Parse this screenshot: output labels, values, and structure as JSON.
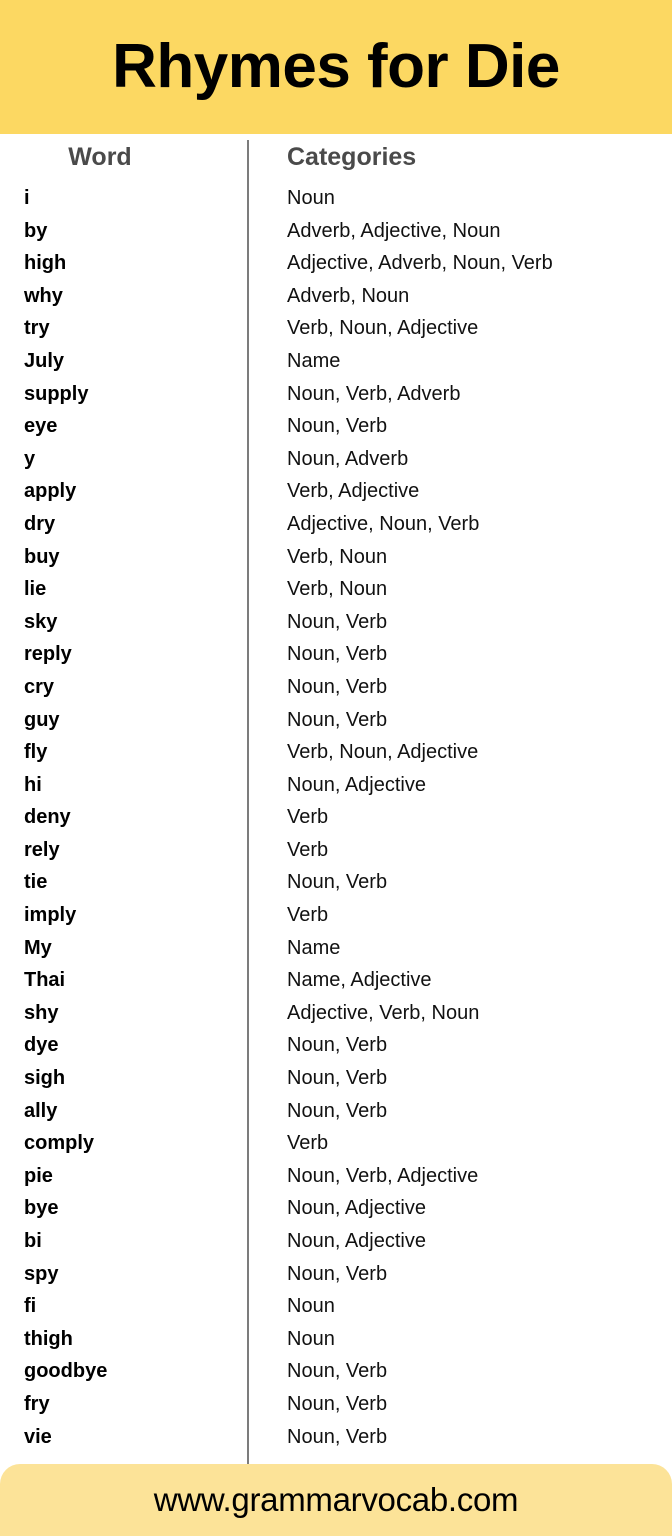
{
  "header": {
    "title": "Rhymes for Die",
    "background_color": "#fcd862"
  },
  "table": {
    "columns": [
      {
        "key": "word",
        "label": "Word"
      },
      {
        "key": "categories",
        "label": "Categories"
      }
    ],
    "divider_color": "#7c7c7c",
    "header_text_color": "#4a4a4a",
    "rows": [
      {
        "word": "i",
        "categories": "Noun"
      },
      {
        "word": "by",
        "categories": "Adverb, Adjective,  Noun"
      },
      {
        "word": "high",
        "categories": "Adjective,  Adverb,  Noun, Verb"
      },
      {
        "word": "why",
        "categories": "Adverb, Noun"
      },
      {
        "word": "try",
        "categories": "Verb, Noun, Adjective"
      },
      {
        "word": "July",
        "categories": "Name"
      },
      {
        "word": "supply",
        "categories": "Noun, Verb, Adverb"
      },
      {
        "word": "eye",
        "categories": "Noun, Verb"
      },
      {
        "word": "y",
        "categories": "Noun, Adverb"
      },
      {
        "word": "apply",
        "categories": "Verb, Adjective"
      },
      {
        "word": "dry",
        "categories": "Adjective,  Noun, Verb"
      },
      {
        "word": "buy",
        "categories": "Verb, Noun"
      },
      {
        "word": "lie",
        "categories": "Verb, Noun"
      },
      {
        "word": "sky",
        "categories": "Noun, Verb"
      },
      {
        "word": "reply",
        "categories": "Noun, Verb"
      },
      {
        "word": "cry",
        "categories": "Noun, Verb"
      },
      {
        "word": "guy",
        "categories": "Noun, Verb"
      },
      {
        "word": "fly",
        "categories": "Verb, Noun, Adjective"
      },
      {
        "word": "hi",
        "categories": "Noun, Adjective"
      },
      {
        "word": "deny",
        "categories": "Verb"
      },
      {
        "word": "rely",
        "categories": "Verb"
      },
      {
        "word": "tie",
        "categories": "Noun, Verb"
      },
      {
        "word": "imply",
        "categories": "Verb"
      },
      {
        "word": "My",
        "categories": "Name"
      },
      {
        "word": "Thai",
        "categories": "Name, Adjective"
      },
      {
        "word": "shy",
        "categories": "Adjective,  Verb, Noun"
      },
      {
        "word": "dye",
        "categories": "Noun, Verb"
      },
      {
        "word": "sigh",
        "categories": "Noun, Verb"
      },
      {
        "word": "ally",
        "categories": "Noun, Verb"
      },
      {
        "word": "comply",
        "categories": "Verb"
      },
      {
        "word": "pie",
        "categories": "Noun, Verb, Adjective"
      },
      {
        "word": "bye",
        "categories": "Noun, Adjective"
      },
      {
        "word": "bi",
        "categories": "Noun, Adjective"
      },
      {
        "word": "spy",
        "categories": "Noun, Verb"
      },
      {
        "word": "fi",
        "categories": "Noun"
      },
      {
        "word": "thigh",
        "categories": "Noun"
      },
      {
        "word": "goodbye",
        "categories": "Noun, Verb"
      },
      {
        "word": "fry",
        "categories": "Noun, Verb"
      },
      {
        "word": "vie",
        "categories": "Noun, Verb"
      }
    ]
  },
  "footer": {
    "url": "www.grammarvocab.com",
    "background_color": "#fce398"
  }
}
